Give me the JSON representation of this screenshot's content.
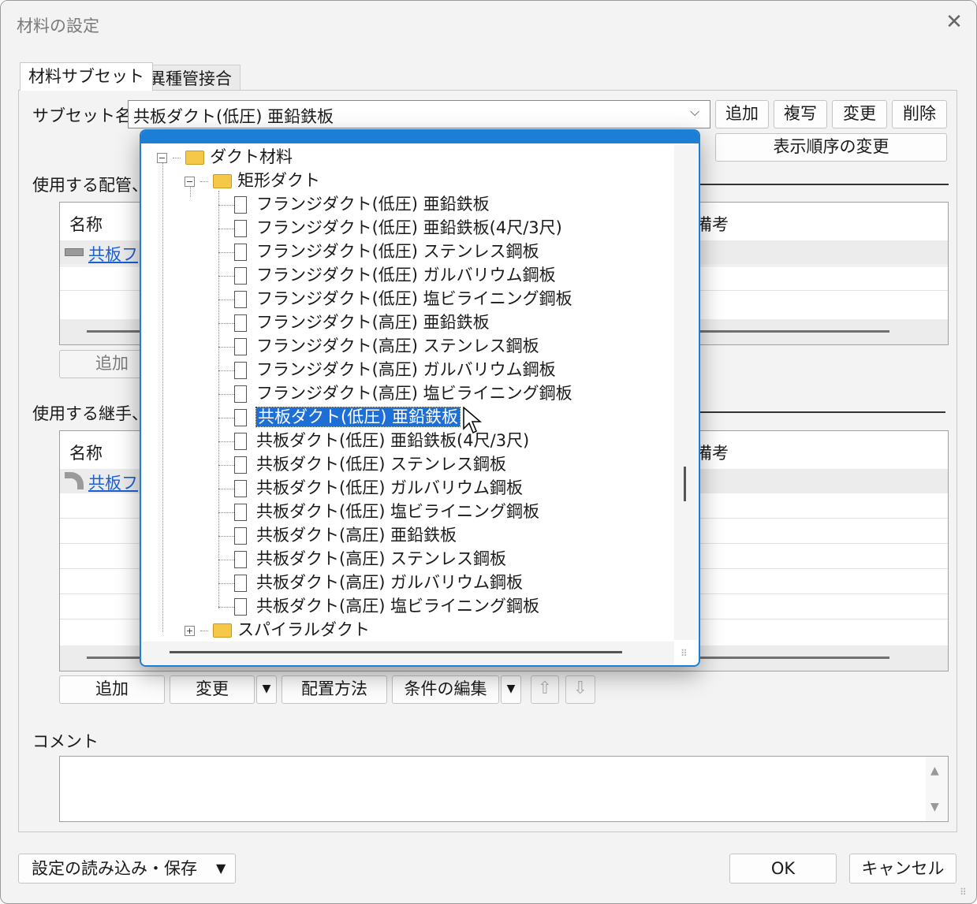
{
  "window": {
    "title": "材料の設定",
    "close_icon": "close-icon"
  },
  "tabs": [
    "材料サブセット",
    "異種管接合"
  ],
  "subset": {
    "label": "サブセット名",
    "value": "共板ダクト(低圧) 亜鉛鉄板",
    "buttons": [
      "追加",
      "複写",
      "変更",
      "削除"
    ],
    "order_button": "表示順序の変更"
  },
  "pipe_section": {
    "label": "使用する配管、",
    "columns": {
      "name": "名称",
      "note": "備考"
    },
    "row_name": "共板フ",
    "add_button": "追加"
  },
  "fitting_section": {
    "label": "使用する継手、",
    "columns": {
      "name": "名称",
      "note": "備考"
    },
    "row_name": "共板フ"
  },
  "toolbar": {
    "add": "追加",
    "change": "変更",
    "placement": "配置方法",
    "edit_conditions": "条件の編集"
  },
  "comment": {
    "label": "コメント"
  },
  "footer": {
    "load_save": "設定の読み込み・保存",
    "ok": "OK",
    "cancel": "キャンセル"
  },
  "tree": {
    "root": "ダクト材料",
    "folder": "矩形ダクト",
    "items": [
      "フランジダクト(低圧) 亜鉛鉄板",
      "フランジダクト(低圧) 亜鉛鉄板(4尺/3尺)",
      "フランジダクト(低圧) ステンレス鋼板",
      "フランジダクト(低圧) ガルバリウム鋼板",
      "フランジダクト(低圧) 塩ビライニング鋼板",
      "フランジダクト(高圧) 亜鉛鉄板",
      "フランジダクト(高圧) ステンレス鋼板",
      "フランジダクト(高圧) ガルバリウム鋼板",
      "フランジダクト(高圧) 塩ビライニング鋼板",
      "共板ダクト(低圧) 亜鉛鉄板",
      "共板ダクト(低圧) 亜鉛鉄板(4尺/3尺)",
      "共板ダクト(低圧) ステンレス鋼板",
      "共板ダクト(低圧) ガルバリウム鋼板",
      "共板ダクト(低圧) 塩ビライニング鋼板",
      "共板ダクト(高圧) 亜鉛鉄板",
      "共板ダクト(高圧) ステンレス鋼板",
      "共板ダクト(高圧) ガルバリウム鋼板",
      "共板ダクト(高圧) 塩ビライニング鋼板"
    ],
    "selected_index": 9,
    "next_folder": "スパイラルダクト"
  },
  "colors": {
    "accent": "#1d7ed6",
    "selection": "#1d6fd6",
    "link": "#1c5fd1"
  }
}
